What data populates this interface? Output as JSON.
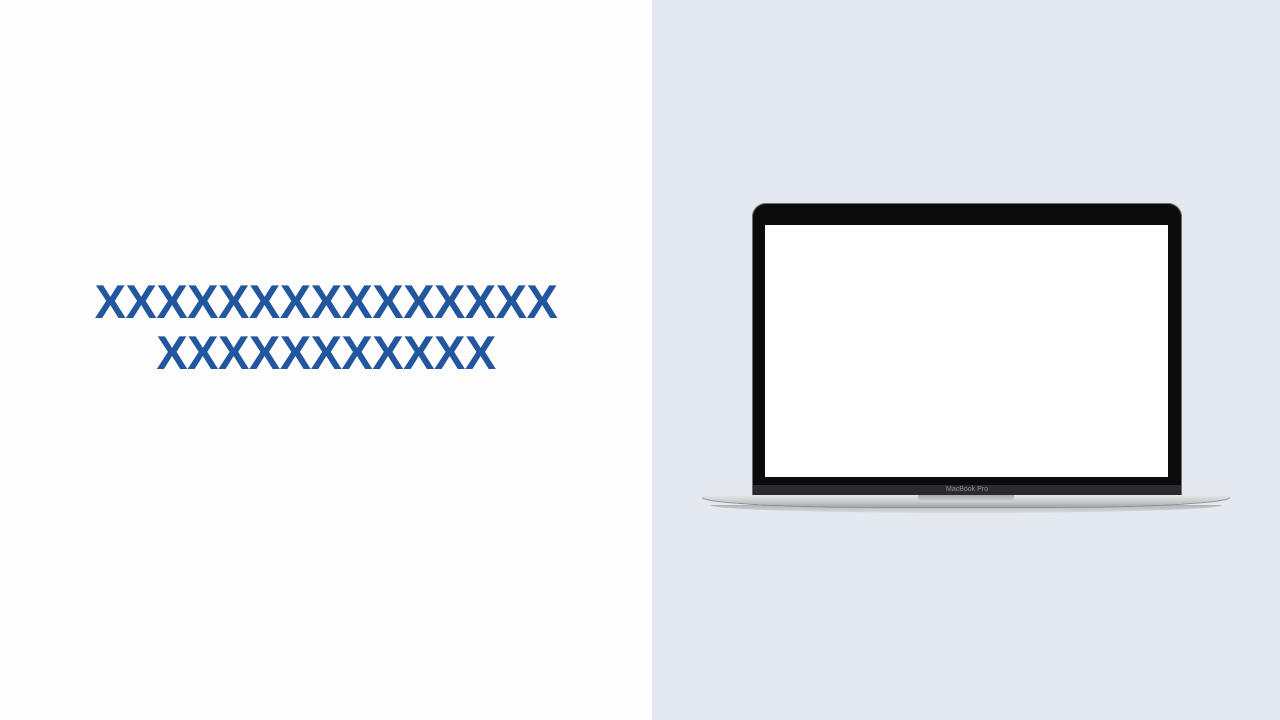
{
  "slide": {
    "title_lines": [
      "XXXXXXXXXXXXXXX",
      "XXXXXXXXXXX"
    ],
    "title_color": "#22569e",
    "left_background": "#fdfdfd",
    "right_background": "#e4e9f0"
  },
  "laptop": {
    "label": "MacBook Pro",
    "screen_color": "#ffffff",
    "bezel_color": "#0b0b0b"
  }
}
